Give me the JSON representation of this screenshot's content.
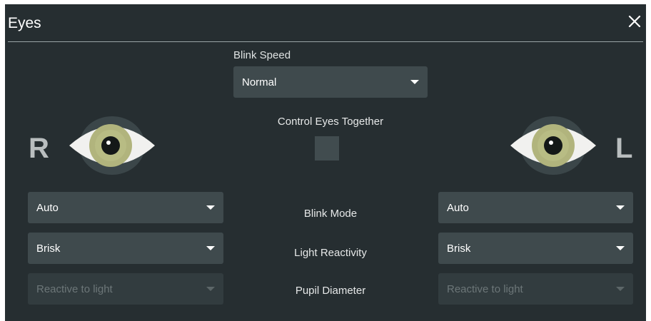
{
  "dialog": {
    "title": "Eyes",
    "close_icon": "close-icon"
  },
  "blink_speed": {
    "label": "Blink Speed",
    "value": "Normal"
  },
  "control_together": {
    "label": "Control Eyes Together",
    "checked": false
  },
  "right_eye": {
    "letter": "R",
    "blink_mode": "Auto",
    "light_reactivity": "Brisk",
    "pupil_diameter": "Reactive to light"
  },
  "left_eye": {
    "letter": "L",
    "blink_mode": "Auto",
    "light_reactivity": "Brisk",
    "pupil_diameter": "Reactive to light"
  },
  "row_labels": {
    "blink_mode": "Blink Mode",
    "light_reactivity": "Light Reactivity",
    "pupil_diameter": "Pupil Diameter"
  },
  "colors": {
    "panel": "#262e31",
    "select": "#3f4a4d",
    "iris": "#b1b47d",
    "sclera": "#f1f1ef"
  }
}
